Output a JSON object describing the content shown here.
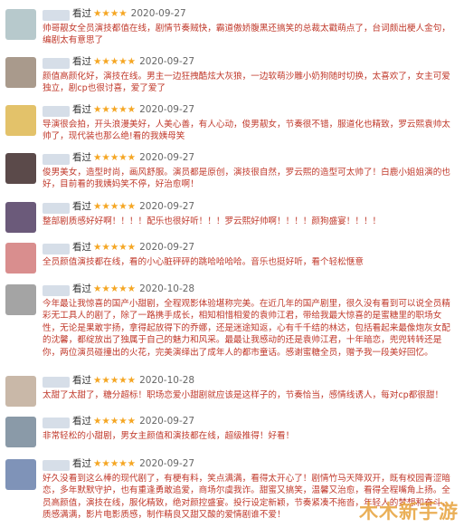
{
  "status_label": "看过",
  "reviews": [
    {
      "stars": "★★★★",
      "date": "2020-09-27",
      "text": "帅哥靓女全员演技都值在线，剧情节奏贼快，霸道傲娇腹黑还搞笑的总裁太戳萌点了，台词颇出梗人金句，编剧太有意思了"
    },
    {
      "stars": "★★★★★",
      "date": "2020-09-27",
      "text": "颜值高颜化好，演技在线。男主一边狂拽酷炫大灰狼，一边软萌沙雕小奶狗随时切换，太喜欢了，女主可爱独立，剧cp也很讨喜，爱了爱了"
    },
    {
      "stars": "★★★★★",
      "date": "2020-09-27",
      "text": "导演很会拍，开头浪漫美好，人美心善，有人心动，俊男靓女，节奏很不错，服道化也精致，罗云熙袁帅太帅了，现代装也那么绝!看的我姨母笑"
    },
    {
      "stars": "★★★★★",
      "date": "2020-09-27",
      "text": "俊男美女，造型时尚，画风舒服。演员都是原创，演技很自然，罗云熙的造型可太帅了！白鹿小姐姐演的也好，目前看的我姨妈笑不停，好治愈啊！"
    },
    {
      "stars": "★★★★★",
      "date": "2020-09-27",
      "text": "整部剧质感好好啊！！！！配乐也很好听！！！罗云熙好帅啊！！！！颜狗盛宴！！！！"
    },
    {
      "stars": "★★★★★",
      "date": "2020-09-27",
      "text": "全员颜值演技都在线，看的小心脏砰砰的跳哈哈哈哈。音乐也挺好听，看个轻松惬意"
    },
    {
      "stars": "★★★★★",
      "date": "2020-10-28",
      "text": "今年最让我惊喜的国产小甜剧，全程观影体验堪称完美。在近几年的国产剧里，很久没有看到可以说全员精彩无工具人的剧了，除了一路携手成长，相知相惜相爱的袁帅江君，带给我最大惊喜的是蜜糖里的职场女性，无论是果敢宇扬，拿得起放得下的乔娜，还是迷途知返，心有千千结的林达，包括看起来最像炮灰女配的沈馨，都绽放出了独属于自己的魅力和风采。最最让我感动的还是袁帅江君，十年暗恋，兜兜转转还是你，两位演员碰撞出的火花，完美演绎出了成年人的都市童话。感谢蜜糖全员，赠予我一段美好回忆。"
    },
    {
      "stars": "★★★★★",
      "date": "2020-10-28",
      "text": "太甜了太甜了，糖分超标！职场恋爱小甜剧就应该是这样子的，节奏恰当，感情线诱人，每对cp都很甜！"
    },
    {
      "stars": "★★★★★",
      "date": "2020-09-27",
      "text": "非常轻松的小甜剧，男女主颜值和演技都在线，超级推得！好看！"
    },
    {
      "stars": "★★★★★",
      "date": "2020-09-27",
      "text": "好久没看到这么棒的现代剧了，有梗有料，笑点满满，看得太开心了！剧情竹马天降双开，既有校园青涩暗恋，多年默默守护，也有重逢勇敢追爱，商场尔虞我诈。甜蜜又搞笑，温馨又治愈，看得全程嘴角上扬。全员高颜值，演技在线，服化精致，绝对颜控盛宴。投行设定新颖，节奏紧凑不拖沓，年轻人的梦想和奋斗，质感满满，影片电影质感，制作精良又甜又酸的爱情剧谁不爱！"
    }
  ],
  "watermark": "木木新手游"
}
